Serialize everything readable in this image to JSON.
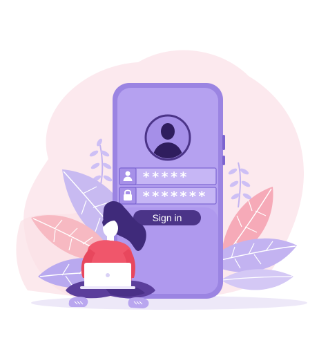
{
  "login_form": {
    "username_value": "*****",
    "password_value": "*******",
    "signin_label": "Sign in"
  },
  "icons": {
    "avatar": "user-silhouette-icon",
    "username": "user-icon",
    "password": "lock-icon"
  },
  "colors": {
    "phone_body": "#a48ce6",
    "phone_screen": "#b9a5f2",
    "phone_border": "#6e56c6",
    "button_fill": "#4b3488",
    "field_border": "#5f47b3",
    "blob_pink": "#fbe8ec",
    "leaf_pink": "#f6b0bb",
    "leaf_lavender": "#c2b5ef",
    "shirt": "#f0566b",
    "pants": "#5b3e9b",
    "hair": "#3f2a7a",
    "laptop": "#ffffff"
  }
}
